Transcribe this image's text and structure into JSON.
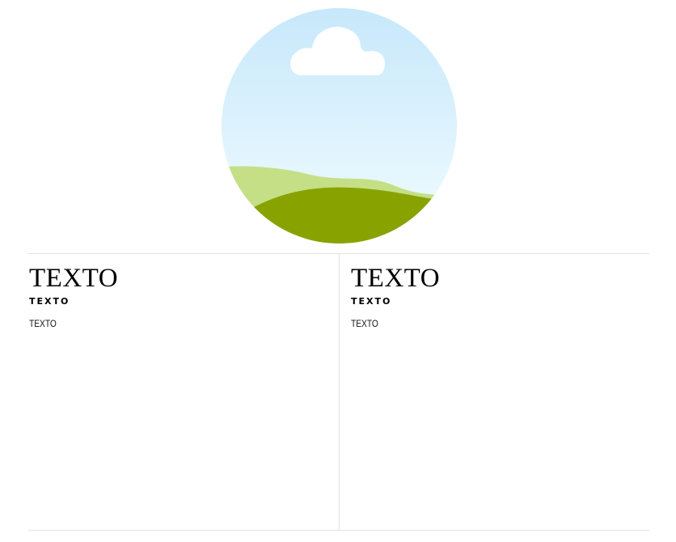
{
  "hero": {
    "icon": "landscape-illustration",
    "colors": {
      "sky_top": "#c7e8fb",
      "sky_bottom": "#eefbff",
      "cloud": "#ffffff",
      "hill_back": "#c5df87",
      "hill_front": "#88a300"
    }
  },
  "columns": [
    {
      "title": "TEXTO",
      "subtitle": "TEXTO",
      "body": "TEXTO"
    },
    {
      "title": "TEXTO",
      "subtitle": "TEXTO",
      "body": "TEXTO"
    }
  ],
  "colors": {
    "rule": "#e2e2e2"
  }
}
